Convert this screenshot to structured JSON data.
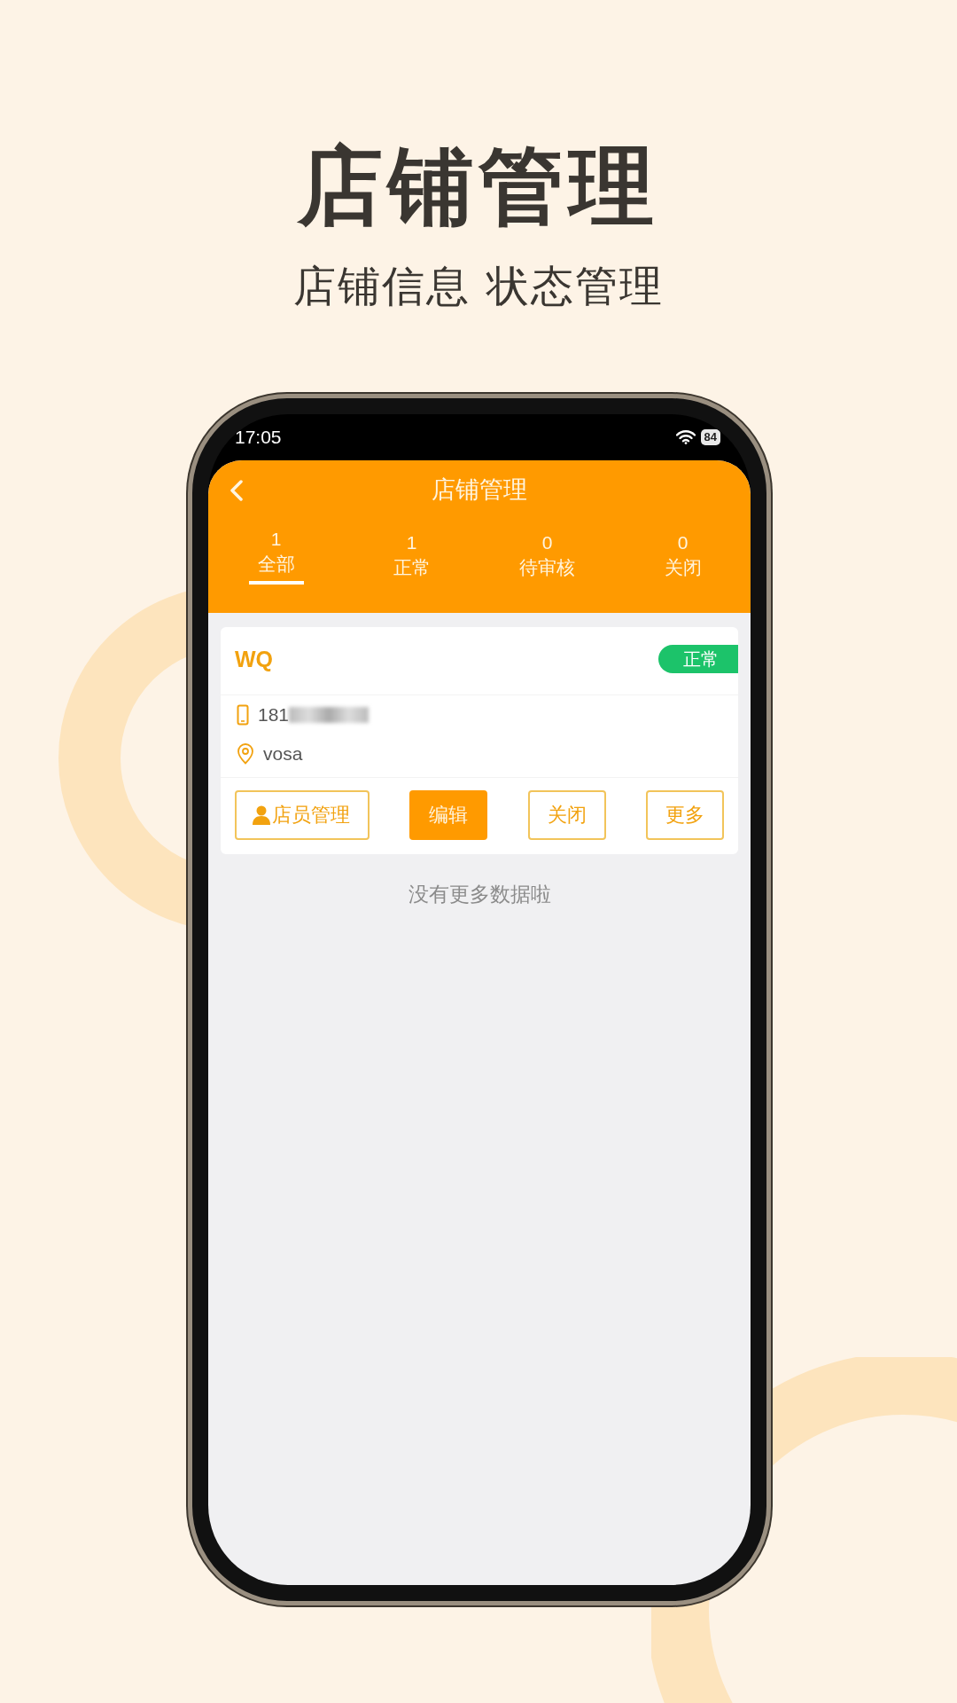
{
  "headline": "店铺管理",
  "subheadline": "店铺信息 状态管理",
  "status_bar": {
    "time": "17:05",
    "battery": "84"
  },
  "nav": {
    "title": "店铺管理"
  },
  "tabs": [
    {
      "count": "1",
      "label": "全部",
      "selected": true
    },
    {
      "count": "1",
      "label": "正常",
      "selected": false
    },
    {
      "count": "0",
      "label": "待审核",
      "selected": false
    },
    {
      "count": "0",
      "label": "关闭",
      "selected": false
    }
  ],
  "stores": [
    {
      "name": "WQ",
      "status": "正常",
      "phone": "181",
      "address": "vosa",
      "actions": [
        {
          "label": "店员管理",
          "kind": "staff"
        },
        {
          "label": "编辑",
          "kind": "primary"
        },
        {
          "label": "关闭",
          "kind": "outline"
        },
        {
          "label": "更多",
          "kind": "outline"
        }
      ]
    }
  ],
  "footer_note": "没有更多数据啦"
}
